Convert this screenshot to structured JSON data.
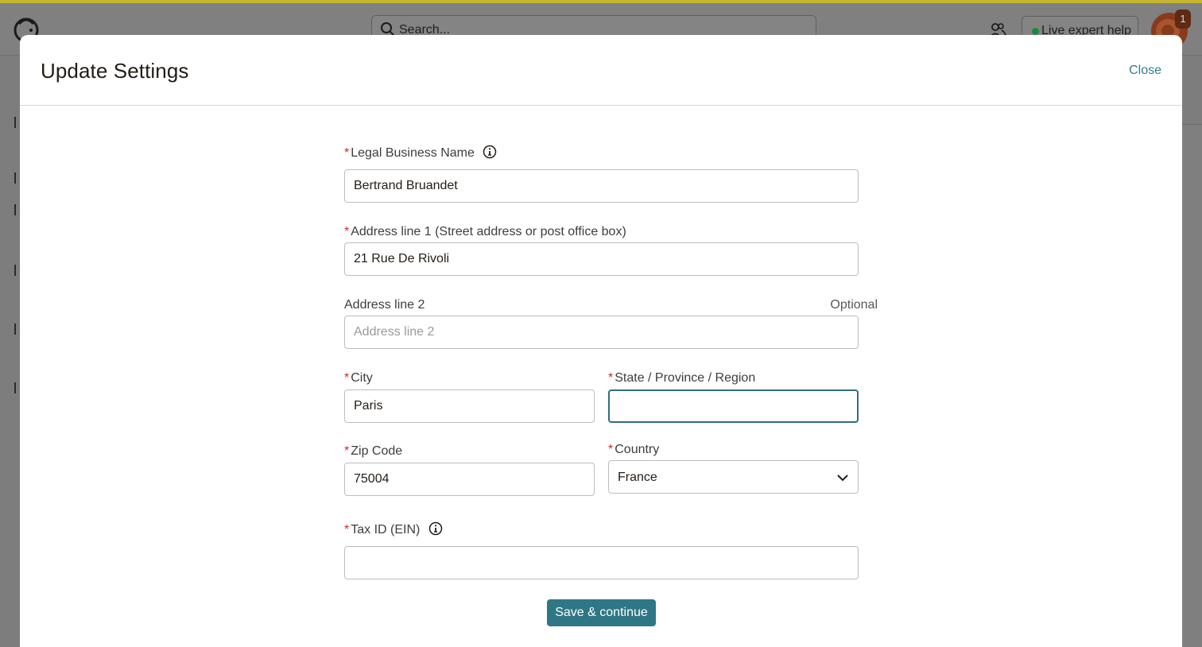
{
  "topbar": {
    "search_placeholder": "Search...",
    "live_help_label": "Live expert help",
    "notification_count": "1",
    "status_dot_color": "#1b8a3a"
  },
  "modal": {
    "title": "Update Settings",
    "close_label": "Close",
    "fields": {
      "legal_name": {
        "label": "Legal Business Name",
        "required_mark": "*",
        "value": "Bertrand Bruandet"
      },
      "address1": {
        "label": "Address line 1 (Street address or post office box)",
        "required_mark": "*",
        "value": "21 Rue De Rivoli"
      },
      "address2": {
        "label": "Address line 2",
        "optional_label": "Optional",
        "placeholder": "Address line 2",
        "value": ""
      },
      "city": {
        "label": "City",
        "required_mark": "*",
        "value": "Paris"
      },
      "state": {
        "label": "State / Province / Region",
        "required_mark": "*",
        "value": ""
      },
      "zip": {
        "label": "Zip Code",
        "required_mark": "*",
        "value": "75004"
      },
      "country": {
        "label": "Country",
        "required_mark": "*",
        "value": "France"
      },
      "tax_id": {
        "label": "Tax ID (EIN)",
        "required_mark": "*",
        "value": ""
      }
    },
    "save_label": "Save & continue"
  },
  "colors": {
    "accent": "#2f7785",
    "link": "#2f7f8a",
    "required": "#d3262a",
    "focus_border": "#2f6f7c"
  }
}
